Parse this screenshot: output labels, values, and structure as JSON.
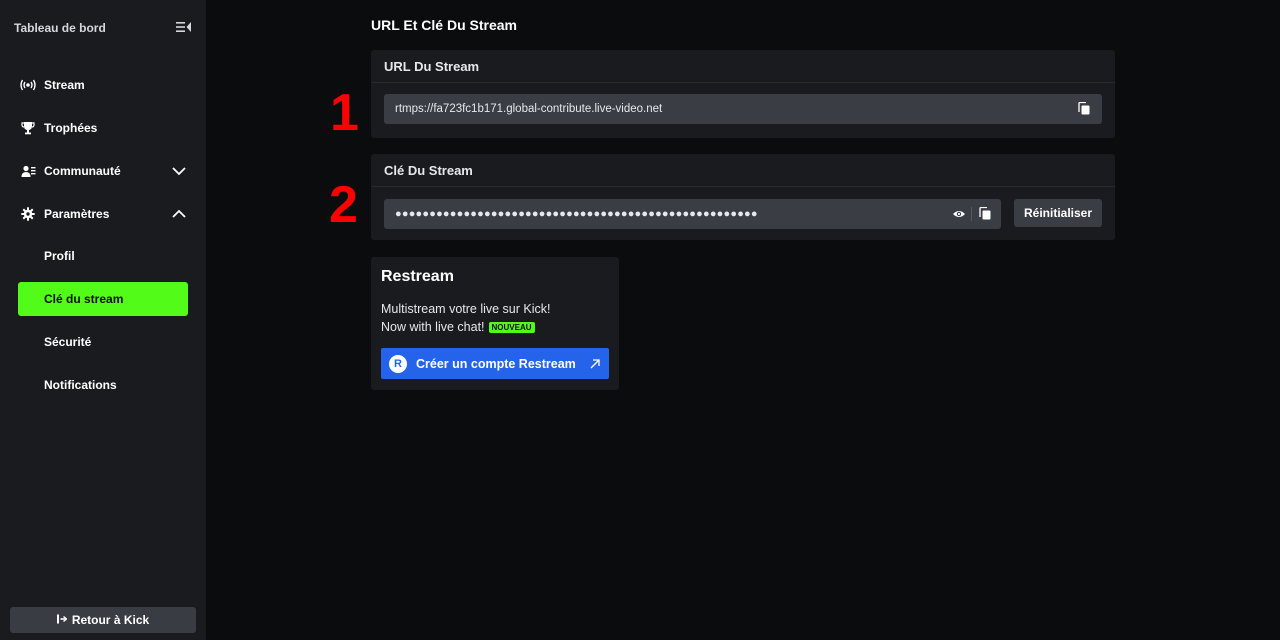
{
  "sidebar": {
    "title": "Tableau de bord",
    "items": [
      {
        "label": "Stream",
        "icon": "broadcast-icon"
      },
      {
        "label": "Trophées",
        "icon": "trophy-icon"
      },
      {
        "label": "Communauté",
        "icon": "community-icon"
      },
      {
        "label": "Paramètres",
        "icon": "gear-icon"
      }
    ],
    "subitems": [
      {
        "label": "Profil"
      },
      {
        "label": "Clé du stream"
      },
      {
        "label": "Sécurité"
      },
      {
        "label": "Notifications"
      }
    ],
    "back_label": "Retour à Kick"
  },
  "main": {
    "title": "URL Et Clé Du Stream",
    "url_card": {
      "heading": "URL Du Stream",
      "value": "rtmps://fa723fc1b171.global-contribute.live-video.net"
    },
    "key_card": {
      "heading": "Clé Du Stream",
      "value": "●●●●●●●●●●●●●●●●●●●●●●●●●●●●●●●●●●●●●●●●●●●●●●●●●●●●●",
      "reset_label": "Réinitialiser"
    },
    "annotations": [
      "1",
      "2"
    ],
    "restream": {
      "title": "Restream",
      "line1": "Multistream votre live sur Kick!",
      "line2": "Now with live chat!",
      "badge": "NOUVEAU",
      "button_label": "Créer un compte Restream",
      "logo_letter": "R"
    }
  },
  "colors": {
    "accent": "#53fc18",
    "annotation": "#ff0000",
    "restream_blue": "#2563eb",
    "sidebar_bg": "#191b1f",
    "page_bg": "#0b0c0d"
  }
}
